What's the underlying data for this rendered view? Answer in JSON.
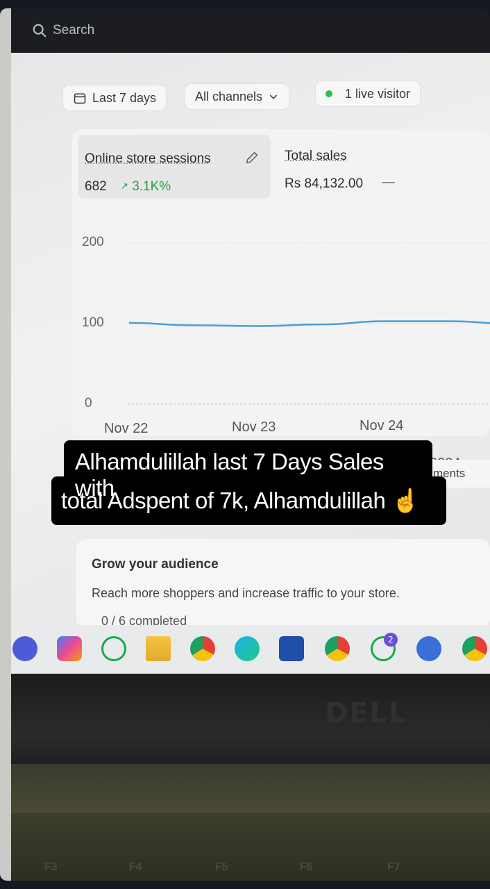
{
  "search": {
    "placeholder": "Search"
  },
  "filters": {
    "date_range": "Last 7 days",
    "channel": "All channels",
    "live": "1 live visitor"
  },
  "metrics": [
    {
      "label": "Online store sessions",
      "value": "682",
      "change": "3.1K%"
    },
    {
      "label": "Total sales",
      "value": "Rs 84,132.00",
      "change": "—"
    }
  ],
  "chart_data": {
    "type": "line",
    "y_ticks": [
      "200",
      "100",
      "0"
    ],
    "ylim": [
      0,
      200
    ],
    "categories": [
      "Nov 22",
      "Nov 23",
      "Nov 24"
    ],
    "series": [
      {
        "name": "Nov 22–Nov 28, 2024",
        "x": [
          0,
          0.5,
          1,
          1.5,
          2,
          2.5,
          3
        ],
        "values": [
          101,
          98,
          97,
          99,
          103,
          103,
          100
        ],
        "color": "#4a9ed8"
      }
    ],
    "grid": true,
    "legend_position": "bottom-right"
  },
  "peek_tab": {
    "label": "ments"
  },
  "grow": {
    "title": "Grow your audience",
    "description": "Reach more shoppers and increase traffic to your store.",
    "progress": "0 / 6 completed"
  },
  "caption": {
    "line1": "Alhamdulillah last 7 Days Sales with",
    "line2": "total Adspent of 7k, Alhamdulillah ☝️"
  },
  "taskbar": {
    "icons": [
      "camera-app-icon",
      "copilot-icon",
      "whatsapp-icon",
      "file-explorer-icon",
      "chrome-icon",
      "edge-icon",
      "microsoft-store-icon",
      "chrome-profile-icon",
      "whatsapp-icon",
      "chrome-remote-icon",
      "chrome-icon"
    ],
    "whatsapp_badge": "2"
  },
  "brand": {
    "laptop": "DELL"
  },
  "keys": [
    "F3",
    "F4",
    "F5",
    "F6",
    "F7"
  ]
}
